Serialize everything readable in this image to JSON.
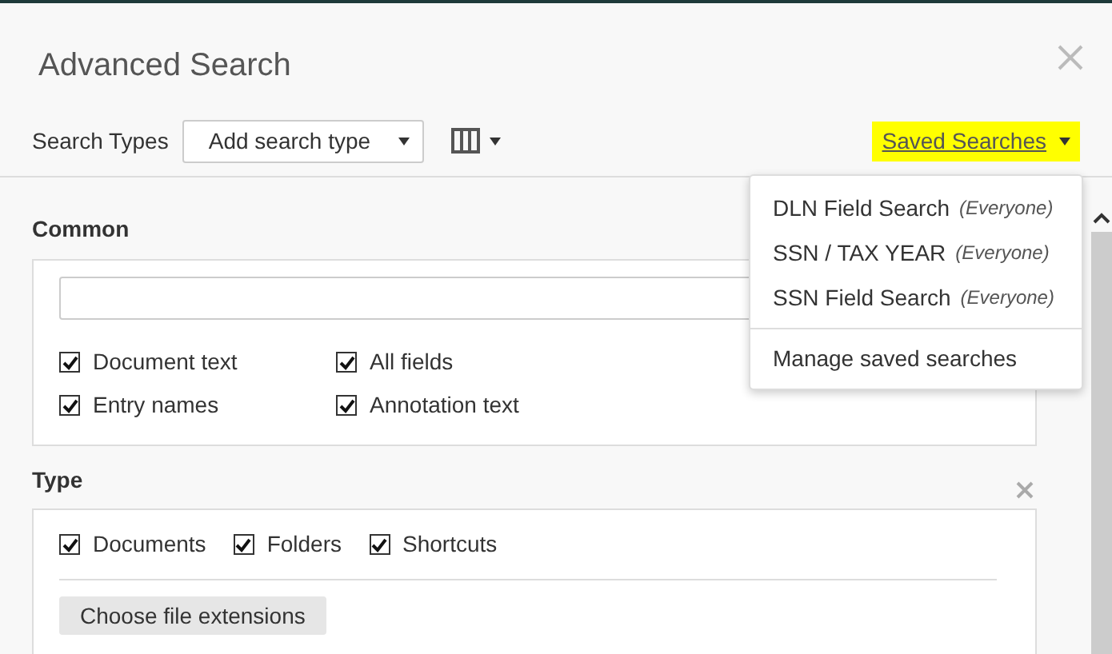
{
  "dialog": {
    "title": "Advanced Search"
  },
  "toolbar": {
    "label": "Search Types",
    "select": {
      "value": "Add search type"
    },
    "saved_searches": {
      "label": "Saved Searches",
      "highlighted": true
    }
  },
  "saved_menu": {
    "items": [
      {
        "name": "DLN Field Search",
        "scope": "(Everyone)"
      },
      {
        "name": "SSN / TAX YEAR",
        "scope": "(Everyone)"
      },
      {
        "name": "SSN Field Search",
        "scope": "(Everyone)"
      }
    ],
    "manage": "Manage saved searches"
  },
  "sections": [
    {
      "title": "Common",
      "removable": false,
      "options": [
        {
          "label": "Document text",
          "checked": true
        },
        {
          "label": "All fields",
          "checked": true
        },
        {
          "label": "Entry names",
          "checked": true
        },
        {
          "label": "Annotation text",
          "checked": true
        }
      ]
    },
    {
      "title": "Type",
      "removable": true,
      "options": [
        {
          "label": "Documents",
          "checked": true
        },
        {
          "label": "Folders",
          "checked": true
        },
        {
          "label": "Shortcuts",
          "checked": true
        }
      ],
      "button": "Choose file extensions"
    }
  ]
}
